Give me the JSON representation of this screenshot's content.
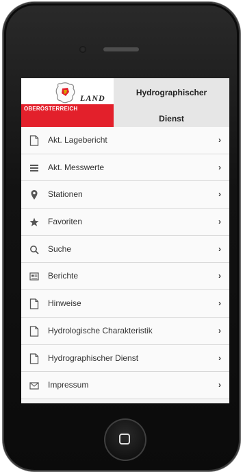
{
  "header": {
    "logo_land": "LAND",
    "logo_state": "OBERÖSTERREICH",
    "title_line1": "Hydrographischer",
    "title_line2": "Dienst"
  },
  "menu": [
    {
      "label": "Akt. Lagebericht",
      "icon": "document-icon"
    },
    {
      "label": "Akt. Messwerte",
      "icon": "list-icon"
    },
    {
      "label": "Stationen",
      "icon": "map-pin-icon"
    },
    {
      "label": "Favoriten",
      "icon": "star-icon"
    },
    {
      "label": "Suche",
      "icon": "search-icon"
    },
    {
      "label": "Berichte",
      "icon": "report-icon"
    },
    {
      "label": "Hinweise",
      "icon": "document-icon"
    },
    {
      "label": "Hydrologische Charakteristik",
      "icon": "document-icon"
    },
    {
      "label": "Hydrographischer Dienst",
      "icon": "document-icon"
    },
    {
      "label": "Impressum",
      "icon": "mail-icon"
    }
  ],
  "colors": {
    "brand_red": "#e3202b",
    "header_gray": "#e6e6e6",
    "phone_body": "#121212"
  }
}
